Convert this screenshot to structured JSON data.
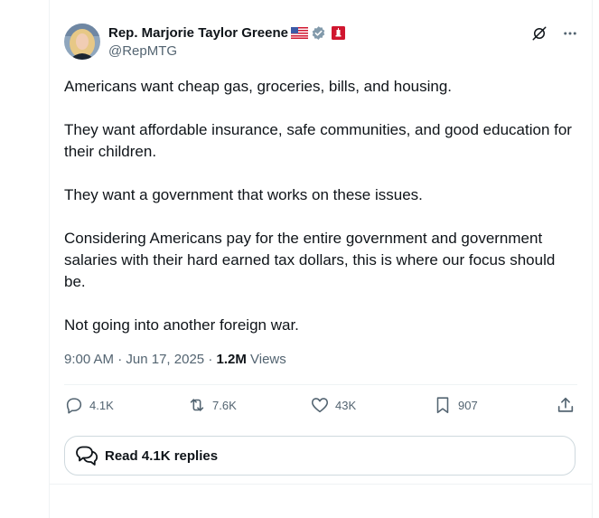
{
  "post": {
    "author": {
      "display_name": "Rep. Marjorie Taylor Greene",
      "handle": "@RepMTG",
      "icons": [
        "us-flag-icon",
        "verified-badge-icon",
        "affiliation-badge-icon"
      ]
    },
    "paragraphs": [
      "Americans want cheap gas, groceries, bills, and housing.",
      "They want affordable insurance, safe communities, and good education for their children.",
      "They want a government that works on these issues.",
      "Considering Americans pay for the entire government and government salaries with their hard earned tax dollars, this is where our focus should be.",
      "Not going into another foreign war."
    ],
    "time": "9:00 AM",
    "separator": "·",
    "date": "Jun 17, 2025",
    "views_count": "1.2M",
    "views_label": "Views"
  },
  "actions": {
    "replies": "4.1K",
    "reposts": "7.6K",
    "likes": "43K",
    "bookmarks": "907"
  },
  "replies_button": {
    "label": "Read 4.1K replies"
  },
  "colors": {
    "text": "#0f1419",
    "secondary": "#536471",
    "border": "#cfd9de",
    "divider": "#eff3f4",
    "verified": "#829aab",
    "affiliation": "#d0162f"
  }
}
